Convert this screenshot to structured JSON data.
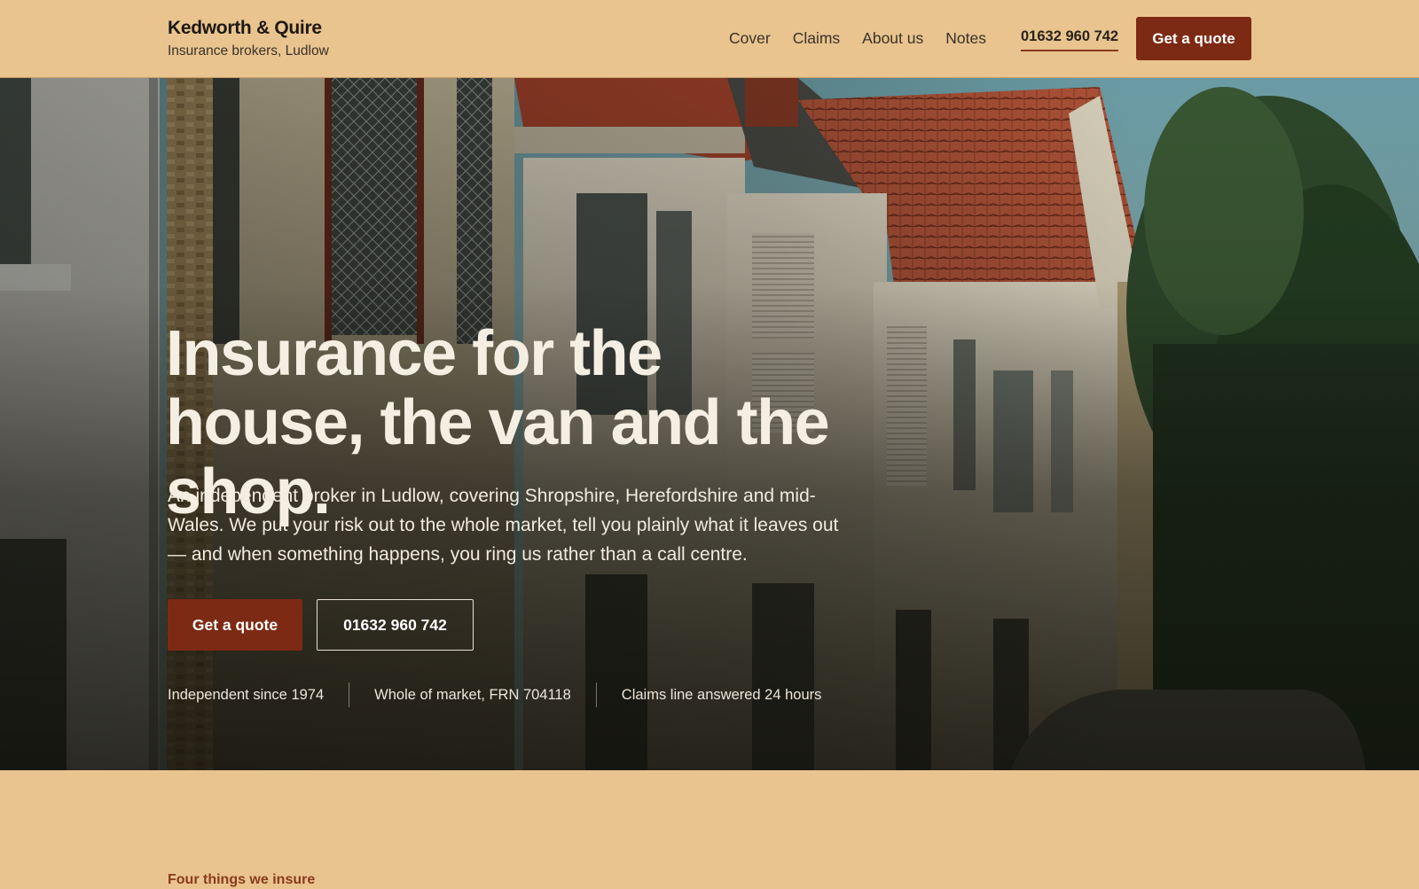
{
  "header": {
    "brand_name": "Kedworth & Quire",
    "brand_tagline": "Insurance brokers, Ludlow",
    "nav": [
      "Cover",
      "Claims",
      "About us",
      "Notes"
    ],
    "phone": "01632 960 742",
    "cta_label": "Get a quote"
  },
  "hero": {
    "title": "Insurance for the house, the van and the shop.",
    "subtitle": "An independent broker in Ludlow, covering Shropshire, Herefordshire and mid-Wales. We put your risk out to the whole market, tell you plainly what it leaves out — and when something happens, you ring us rather than a call centre.",
    "primary_cta": "Get a quote",
    "secondary_cta": "01632 960 742",
    "trust": [
      "Independent since 1974",
      "Whole of market, FRN 704118",
      "Claims line answered 24 hours"
    ]
  },
  "next_section": {
    "eyebrow": "Four things we insure"
  },
  "colors": {
    "page_background": "#e9c48f",
    "accent": "#7d2a14"
  }
}
